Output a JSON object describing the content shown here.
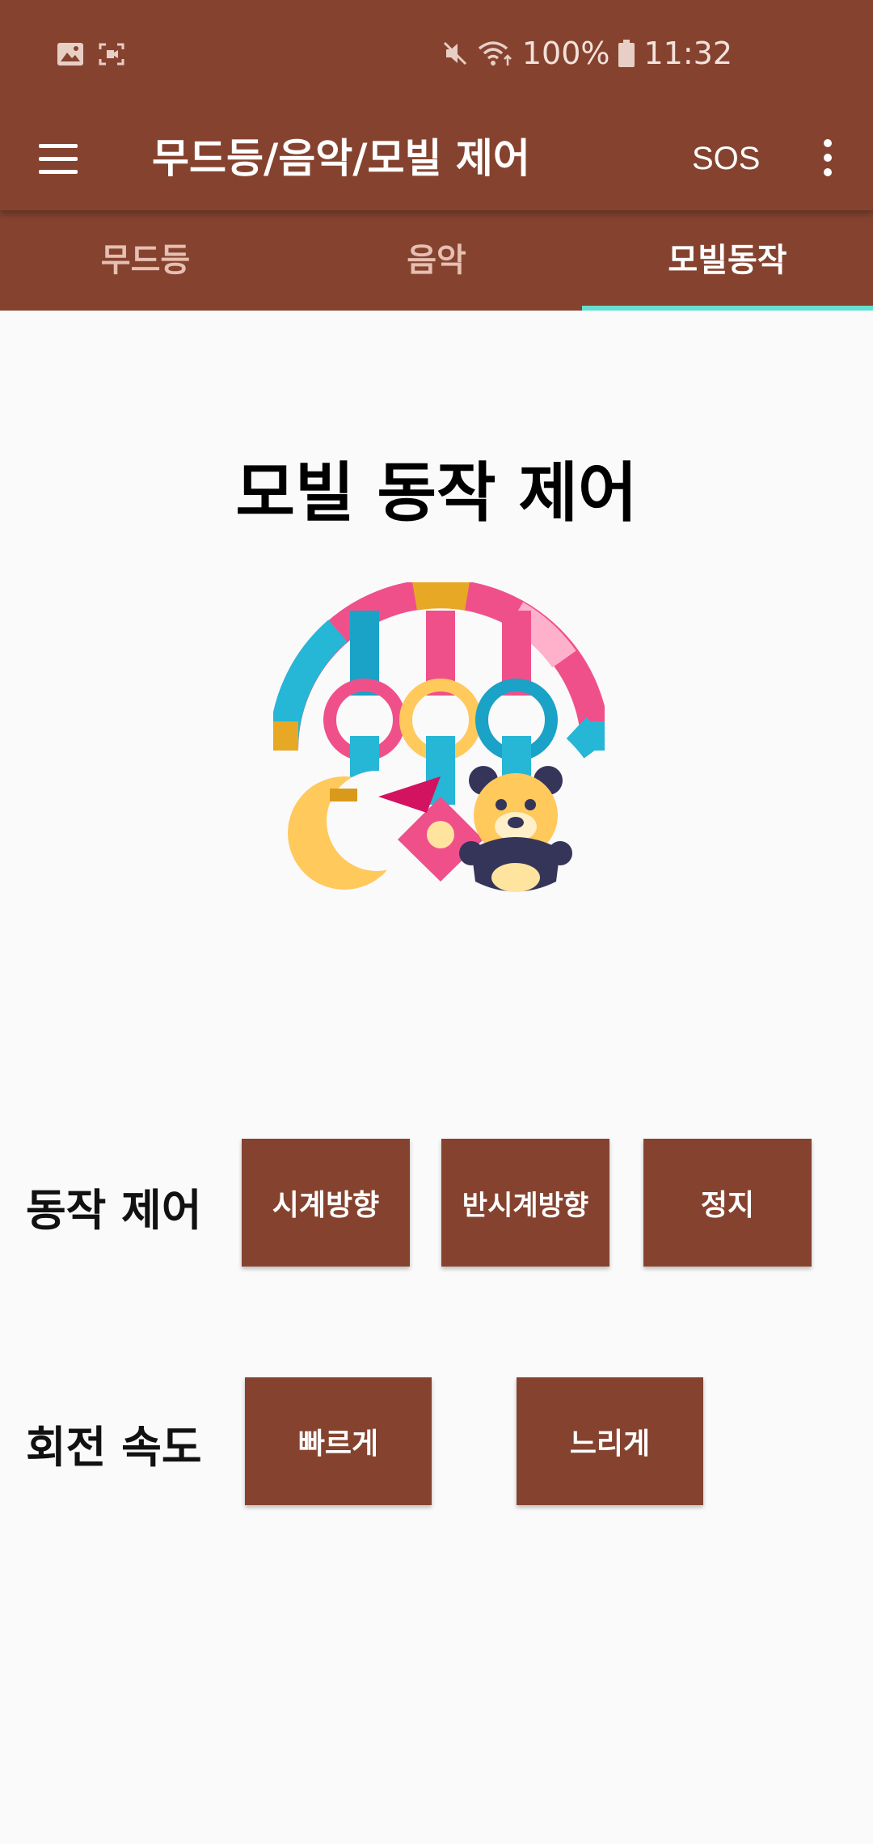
{
  "status_bar": {
    "left_icons": [
      "gallery-icon",
      "screen-record-icon"
    ],
    "right_icons": [
      "mute-icon",
      "wifi-icon",
      "battery-icon"
    ],
    "battery": "100%",
    "time": "11:32"
  },
  "app_bar": {
    "title": "무드등/음악/모빌 제어",
    "sos_label": "SOS",
    "icons": [
      "menu-icon",
      "more-vert-icon"
    ]
  },
  "tabs": [
    {
      "label": "무드등",
      "active": false
    },
    {
      "label": "음악",
      "active": false
    },
    {
      "label": "모빌동작",
      "active": true
    }
  ],
  "main": {
    "title": "모빌 동작 제어",
    "illustration": "baby-mobile-icon",
    "motion_control": {
      "label": "동작 제어",
      "buttons": [
        "시계방향",
        "반시계방향",
        "정지"
      ]
    },
    "rotation_speed": {
      "label": "회전 속도",
      "buttons": [
        "빠르게",
        "느리게"
      ]
    }
  },
  "colors": {
    "primary": "#85432f",
    "tab_indicator": "#64dfd0",
    "background": "#fafafa"
  }
}
